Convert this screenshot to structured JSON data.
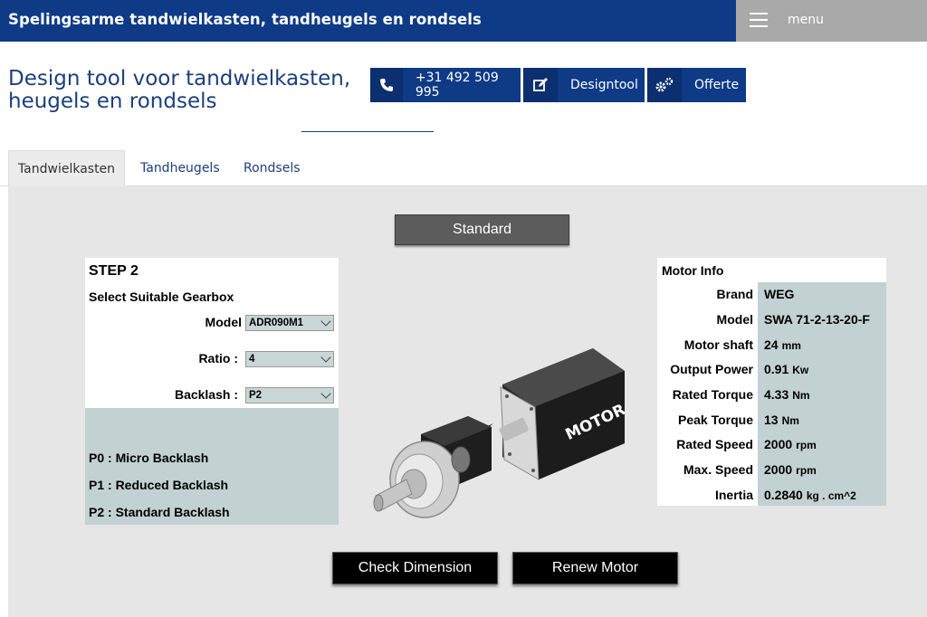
{
  "header": {
    "title": "Spelingsarme tandwielkasten, tandheugels en rondsels",
    "menu_label": "menu"
  },
  "page": {
    "title": "Design tool voor tandwielkasten, heugels en rondsels"
  },
  "actions": {
    "phone": "+31 492 509 995",
    "designtool": "Designtool",
    "offerte": "Offerte"
  },
  "tabs": [
    {
      "label": "Tandwielkasten",
      "active": true
    },
    {
      "label": "Tandheugels",
      "active": false
    },
    {
      "label": "Rondsels",
      "active": false
    }
  ],
  "standard_button": "Standard",
  "step": {
    "title": "STEP 2",
    "subtitle": "Select Suitable Gearbox",
    "model_label": "Model",
    "model_value": "ADR090M1",
    "ratio_label": "Ratio :",
    "ratio_value": "4",
    "backlash_label": "Backlash :",
    "backlash_value": "P2",
    "legend": [
      "P0 : Micro Backlash",
      "P1 : Reduced Backlash",
      "P2 : Standard Backlash"
    ]
  },
  "motor_image_label": "MOTOR",
  "motor_info": {
    "header": "Motor Info",
    "rows": [
      {
        "key": "Brand",
        "value": "WEG",
        "unit": ""
      },
      {
        "key": "Model",
        "value": "SWA 71-2-13-20-F",
        "unit": ""
      },
      {
        "key": "Motor shaft",
        "value": "24",
        "unit": "mm"
      },
      {
        "key": "Output Power",
        "value": "0.91",
        "unit": "Kw"
      },
      {
        "key": "Rated Torque",
        "value": "4.33",
        "unit": "Nm"
      },
      {
        "key": "Peak Torque",
        "value": "13",
        "unit": "Nm"
      },
      {
        "key": "Rated Speed",
        "value": "2000",
        "unit": "rpm"
      },
      {
        "key": "Max. Speed",
        "value": "2000",
        "unit": "rpm"
      },
      {
        "key": "Inertia",
        "value": "0.2840",
        "unit": "kg . cm^2"
      }
    ]
  },
  "buttons": {
    "check_dimension": "Check Dimension",
    "renew_motor": "Renew Motor"
  },
  "colors": {
    "brand_blue": "#0e3a86",
    "panel_gray": "#e6e6e6",
    "table_teal": "#c2d1d1"
  }
}
